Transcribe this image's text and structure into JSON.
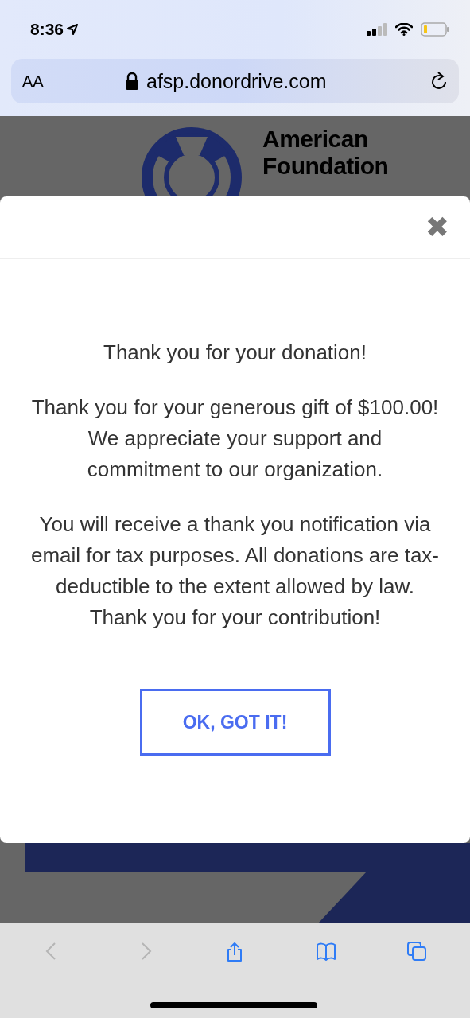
{
  "status_bar": {
    "time": "8:36"
  },
  "address_bar": {
    "text_size_label": "AA",
    "url": "afsp.donordrive.com"
  },
  "page": {
    "logo_lines": [
      "American",
      "Foundation"
    ]
  },
  "modal": {
    "close_label": "✖",
    "title": "Thank you for your donation!",
    "paragraphs": [
      "Thank you for your generous gift of $100.00! We appreciate your support and commitment to our organization.",
      "You will receive a thank you notification via email for tax purposes. All donations are tax-deductible to the extent allowed by law. Thank you for your contribution!"
    ],
    "button": "OK, GOT IT!"
  },
  "toolbar": [
    {
      "kind": "back",
      "disabled": true
    },
    {
      "kind": "forward",
      "disabled": true
    },
    {
      "kind": "share",
      "disabled": false
    },
    {
      "kind": "bookmarks",
      "disabled": false
    },
    {
      "kind": "tabs",
      "disabled": false
    }
  ]
}
